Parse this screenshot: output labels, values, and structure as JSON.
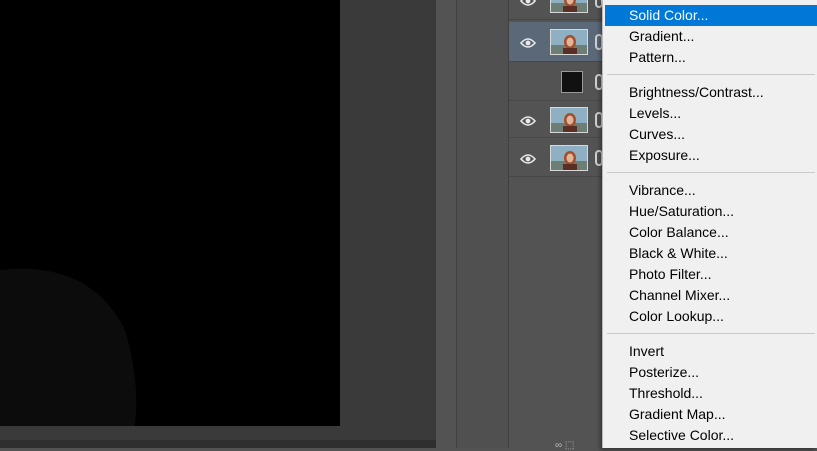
{
  "menu": {
    "groups": [
      [
        "Solid Color...",
        "Gradient...",
        "Pattern..."
      ],
      [
        "Brightness/Contrast...",
        "Levels...",
        "Curves...",
        "Exposure..."
      ],
      [
        "Vibrance...",
        "Hue/Saturation...",
        "Color Balance...",
        "Black & White...",
        "Photo Filter...",
        "Channel Mixer...",
        "Color Lookup..."
      ],
      [
        "Invert",
        "Posterize...",
        "Threshold...",
        "Gradient Map...",
        "Selective Color..."
      ]
    ],
    "highlighted": "Solid Color...",
    "highlight_color": "#0078d7"
  },
  "layers": [
    {
      "type": "photo",
      "visible": true,
      "selected": false
    },
    {
      "type": "photo",
      "visible": true,
      "selected": true
    },
    {
      "type": "black-fill",
      "visible": false,
      "selected": false
    },
    {
      "type": "photo",
      "visible": true,
      "selected": false
    },
    {
      "type": "photo",
      "visible": true,
      "selected": false
    }
  ],
  "icons": {
    "visibility": "eye-icon",
    "link": "chain-link-icon"
  }
}
